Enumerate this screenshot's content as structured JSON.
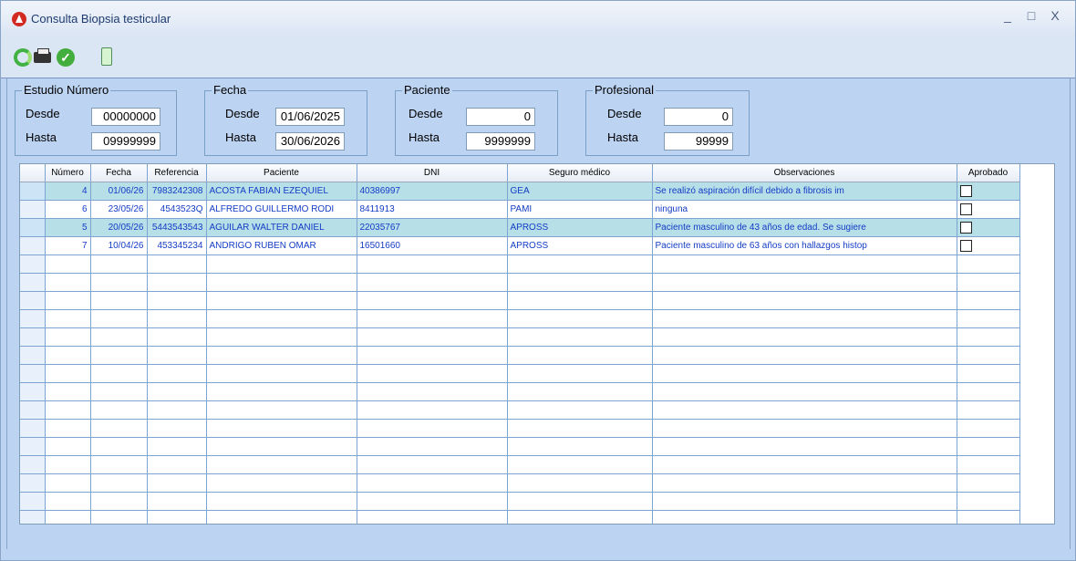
{
  "window": {
    "title": "Consulta Biopsia testicular"
  },
  "controls": {
    "minimize": "_",
    "maximize": "□",
    "close": "X"
  },
  "toolbar": {
    "icons": [
      "refresh-icon",
      "printer-icon",
      "approve-icon",
      "specimen-icon"
    ],
    "check_glyph": "✓"
  },
  "filters": {
    "study": {
      "title": "Estudio Número",
      "from_label": "Desde",
      "to_label": "Hasta",
      "from": "00000000",
      "to": "09999999"
    },
    "date": {
      "title": "Fecha",
      "from_label": "Desde",
      "to_label": "Hasta",
      "from": "01/06/2025",
      "to": "30/06/2026"
    },
    "patient": {
      "title": "Paciente",
      "from_label": "Desde",
      "to_label": "Hasta",
      "from": "0",
      "to": "9999999"
    },
    "professional": {
      "title": "Profesional",
      "from_label": "Desde",
      "to_label": "Hasta",
      "from": "0",
      "to": "99999"
    }
  },
  "grid": {
    "columns": [
      "Número",
      "Fecha",
      "Referencia",
      "Paciente",
      "DNI",
      "Seguro médico",
      "Observaciones",
      "Aprobado"
    ],
    "rows": [
      [
        "4",
        "01/06/26",
        "7983242308",
        "ACOSTA FABIAN EZEQUIEL",
        "40386997",
        "GEA",
        "Se realizó aspiración difícil debido a fibrosis im"
      ],
      [
        "6",
        "23/05/26",
        "4543523Q",
        "ALFREDO GUILLERMO RODI",
        "8411913",
        "PAMI",
        "ninguna"
      ],
      [
        "5",
        "20/05/26",
        "5443543543",
        "AGUILAR WALTER DANIEL",
        "22035767",
        "APROSS",
        "Paciente masculino de 43 años de edad. Se sugiere"
      ],
      [
        "7",
        "10/04/26",
        "453345234",
        "ANDRIGO RUBEN OMAR",
        "16501660",
        "APROSS",
        "Paciente masculino de 63 años con hallazgos histop"
      ]
    ]
  }
}
